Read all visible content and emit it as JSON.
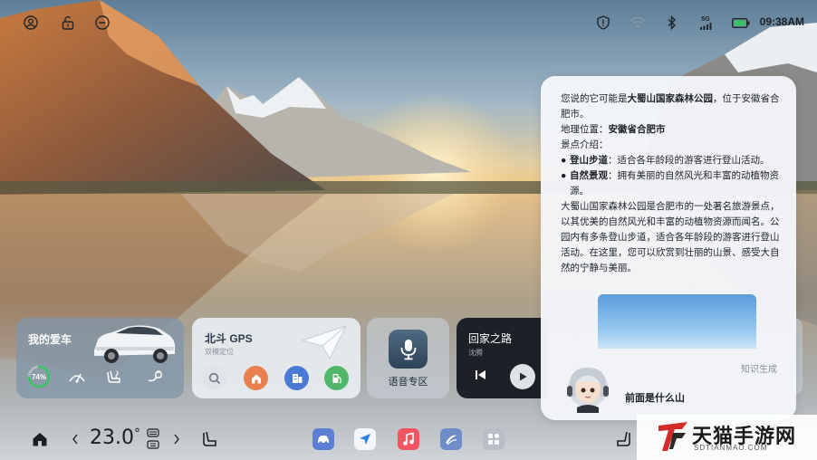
{
  "status_bar": {
    "time": "09:38AM",
    "network_label": "5G",
    "icons": [
      "user-icon",
      "lock-icon",
      "minus-circle-icon",
      "shield-icon",
      "wifi-icon",
      "bluetooth-icon",
      "signal-5g-icon",
      "battery-icon"
    ]
  },
  "car_card": {
    "title": "我的爱车",
    "battery_percent": 74,
    "battery_label": "74%",
    "controls": [
      "wiper-icon",
      "seat-heat-icon",
      "charging-icon"
    ]
  },
  "gps_card": {
    "title": "北斗 GPS",
    "subtitle": "双模定位",
    "shortcuts": [
      "search-icon",
      "home-icon",
      "company-icon",
      "gas-station-icon"
    ]
  },
  "voice_card": {
    "label": "语音专区"
  },
  "music_card": {
    "title": "回家之路",
    "artist": "沈腾"
  },
  "chat": {
    "intro_pre": "您说的它可能是",
    "intro_bold": "大蜀山国家森林公园",
    "intro_post": "，位于安徽省合肥市。",
    "location_label": "地理位置：",
    "location_value": "安徽省合肥市",
    "scenic_label": "景点介绍：",
    "bullet1_bold": "登山步道",
    "bullet1_text": "：适合各年龄段的游客进行登山活动。",
    "bullet2_bold": "自然景观",
    "bullet2_text": "：拥有美丽的自然风光和丰富的动植物资源。",
    "paragraph": "大蜀山国家森林公园是合肥市的一处著名旅游景点，以其优美的自然风光和丰富的动植物资源而闻名。公园内有多条登山步道，适合各年龄段的游客进行登山活动。在这里，您可以欣赏到壮丽的山景、感受大自然的宁静与美丽。",
    "generated_label": "知识生成",
    "query": "前面是什么山"
  },
  "dock": {
    "temperature": "23.0",
    "temperature_unit": "°",
    "apps": [
      "car-app-icon",
      "navigation-app-icon",
      "music-app-icon",
      "media-app-icon",
      "apps-grid-icon"
    ]
  },
  "watermark": {
    "title": "天猫手游网",
    "url": "SDTIANMAO.COM"
  },
  "colors": {
    "accent_green": "#3cc264",
    "home_orange": "#e8804f",
    "company_blue": "#4a79d6",
    "gas_green": "#4fb66a"
  }
}
